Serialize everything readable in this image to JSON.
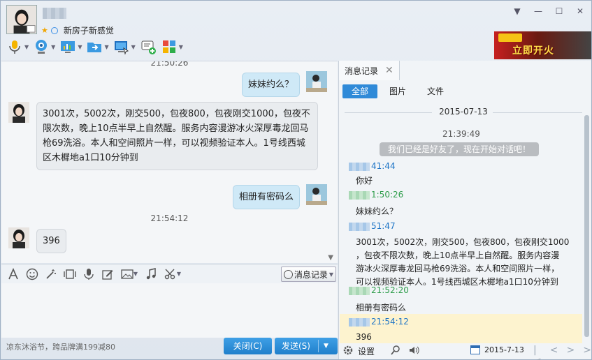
{
  "header": {
    "signature": "新房子新感觉",
    "ad_text": "立即开火"
  },
  "chat": {
    "top_partial_time": "21:50:26",
    "messages": [
      {
        "dir": "out",
        "text": "妹妹约么？"
      },
      {
        "dir": "in",
        "lines": [
          "3001次，5002次，刚交500，包夜800，包夜刚交1000，包夜不",
          "限次数，晚上10点半早上自然醒。服务内容漫游冰火深厚毒龙回马",
          "枪69洗浴。本人和空间照片一样，可以视频验证本人。1号线西城",
          "区木樨地a1口10分钟到"
        ]
      },
      {
        "dir": "out",
        "text": "相册有密码么"
      },
      {
        "time": "21:54:12"
      },
      {
        "dir": "in",
        "text": "396"
      }
    ]
  },
  "input": {
    "history_label": "消息记录",
    "footer_promo": "凉东沐浴节，跨品牌满199减80",
    "close_label": "关闭(C)",
    "send_label": "发送(S)"
  },
  "panel": {
    "tab_label": "消息记录",
    "subtabs": [
      "全部",
      "图片",
      "文件"
    ],
    "date": "2015-07-13",
    "first_time": "21:39:49",
    "system_msg": "我们已经是好友了，现在开始对话吧！",
    "entries": [
      {
        "who": "blue",
        "time": "41:44",
        "text": [
          "你好"
        ]
      },
      {
        "who": "green",
        "time": "1:50:26",
        "text": [
          "妹妹约么？"
        ]
      },
      {
        "who": "blue",
        "time": "51:47",
        "text": [
          "3001次，5002次，刚交500，包夜800，包夜刚交1000",
          "，包夜不限次数，晚上10点半早上自然醒。服务内容漫",
          "游冰火深厚毒龙回马枪69洗浴。本人和空间照片一样，",
          "可以视频验证本人。1号线西城区木樨地a1口10分钟到"
        ]
      },
      {
        "who": "green",
        "time": "21:52:20",
        "text": [
          "相册有密码么"
        ]
      },
      {
        "who": "blue",
        "time": "21:54:12",
        "text": [
          "396"
        ]
      }
    ],
    "settings_label": "设置",
    "footer_date": "2015-7-13"
  },
  "colors": {
    "accent": "#2f8ad8",
    "outgoing_bubble": "#cfe9f7",
    "incoming_bubble": "#e9ecef",
    "highlight": "#fdf3cf"
  }
}
